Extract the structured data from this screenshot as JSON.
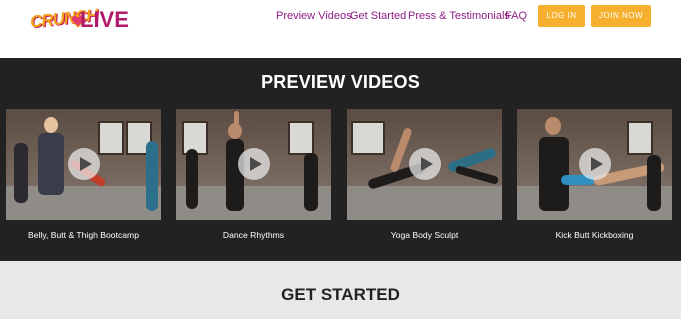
{
  "header": {
    "logo_crunch": "CRUNCH",
    "logo_live": "LIVE",
    "nav": {
      "preview_videos": "Preview Videos",
      "get_started": "Get Started",
      "press": "Press & Testimonials",
      "faq": "FAQ"
    },
    "login_label": "LOG IN",
    "join_label": "JOIN NOW"
  },
  "preview": {
    "title": "PREVIEW VIDEOS",
    "videos": [
      {
        "label": "Belly, Butt & Thigh Bootcamp"
      },
      {
        "label": "Dance Rhythms"
      },
      {
        "label": "Yoga Body Sculpt"
      },
      {
        "label": "Kick Butt Kickboxing"
      }
    ]
  },
  "get_started": {
    "title": "GET STARTED"
  },
  "colors": {
    "nav_text": "#8e1d84",
    "button_bg": "#f7b02e",
    "dark_section": "#222222",
    "light_section": "#e8e8e8"
  }
}
